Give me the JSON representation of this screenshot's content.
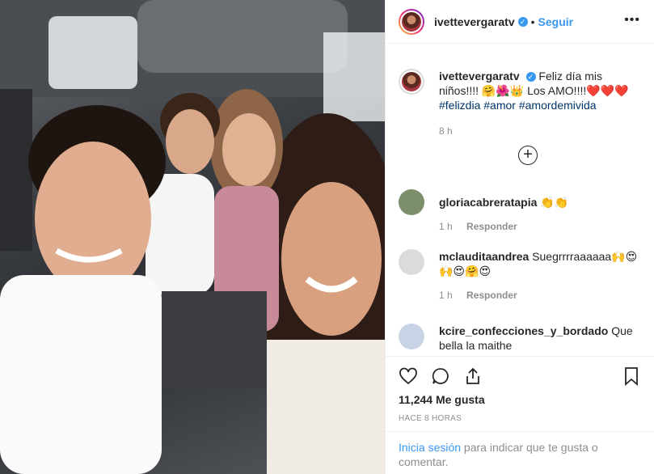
{
  "post": {
    "username": "ivettevergaratv",
    "verified_mark": "✓",
    "separator": "•",
    "follow_label": "Seguir",
    "more_icon": "more-options-icon"
  },
  "caption": {
    "username": "ivettevergaratv",
    "text": "Feliz día mis niños!!!! 🤗🌺👑 Los AMO!!!!❤️❤️❤️",
    "hashtags": [
      "#felizdia",
      "#amor",
      "#amordemivida"
    ],
    "age": "8 h"
  },
  "load_more_icon": "plus-circle-icon",
  "comments": [
    {
      "username": "gloriacabreratapia",
      "text": "👏👏",
      "age": "1 h",
      "reply": "Responder"
    },
    {
      "username": "mclauditaandrea",
      "text": "Suegrrrraaaaaa🙌😍🙌😍🤗😍",
      "age": "1 h",
      "reply": "Responder"
    },
    {
      "username": "kcire_confecciones_y_bordado",
      "text": "Que bella la maithe",
      "age": "",
      "reply": ""
    }
  ],
  "actions": {
    "like_icon": "heart-icon",
    "comment_icon": "comment-icon",
    "share_icon": "share-icon",
    "save_icon": "bookmark-icon"
  },
  "likes": "11,244 Me gusta",
  "timestamp": "HACE 8 HORAS",
  "login": {
    "link": "Inicia sesión",
    "text": " para indicar que te gusta o comentar."
  },
  "colors": {
    "accent": "#3897f0",
    "hashtag": "#003569",
    "muted": "#8e8e8e"
  }
}
